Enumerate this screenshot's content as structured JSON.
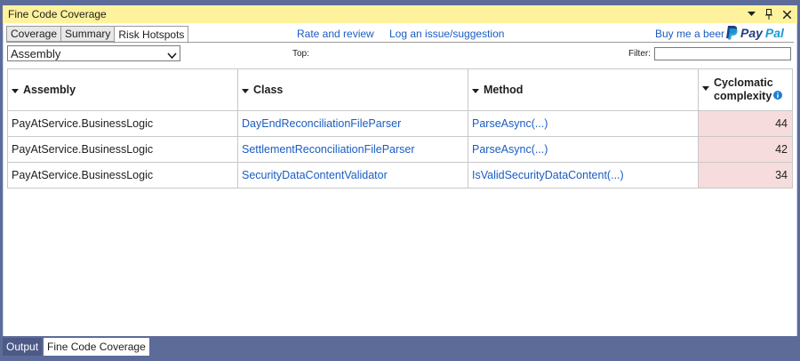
{
  "window": {
    "title": "Fine Code Coverage",
    "controls": [
      "dropdown-icon",
      "pin-icon",
      "close-icon"
    ]
  },
  "tabs": [
    {
      "label": "Coverage"
    },
    {
      "label": "Summary"
    },
    {
      "label": "Risk Hotspots",
      "active": true
    }
  ],
  "links": {
    "rate": "Rate and review",
    "issue": "Log an issue/suggestion",
    "beer": "Buy me a beer",
    "paypal_pay": "Pay",
    "paypal_pal": "Pal"
  },
  "toolbar": {
    "group_select": "Assembly",
    "top_label": "Top:",
    "filter_label": "Filter:",
    "filter_value": ""
  },
  "table": {
    "headers": [
      "Assembly",
      "Class",
      "Method",
      "Cyclomatic complexity"
    ],
    "rows": [
      {
        "assembly": "PayAtService.BusinessLogic",
        "class": "DayEndReconciliationFileParser",
        "method": "ParseAsync(...)",
        "complexity": "44"
      },
      {
        "assembly": "PayAtService.BusinessLogic",
        "class": "SettlementReconciliationFileParser",
        "method": "ParseAsync(...)",
        "complexity": "42"
      },
      {
        "assembly": "PayAtService.BusinessLogic",
        "class": "SecurityDataContentValidator",
        "method": "IsValidSecurityDataContent(...)",
        "complexity": "34"
      }
    ]
  },
  "cc_header": {
    "line1": "Cyclomatic",
    "line2": "complexity"
  },
  "bottom_tabs": [
    {
      "label": "Output"
    },
    {
      "label": "Fine Code Coverage",
      "active": true
    }
  ],
  "colors": {
    "titlebar": "#fff29d",
    "frame": "#5d6b99",
    "link": "#1a5cc2",
    "hotspot": "#f6dcdc"
  }
}
